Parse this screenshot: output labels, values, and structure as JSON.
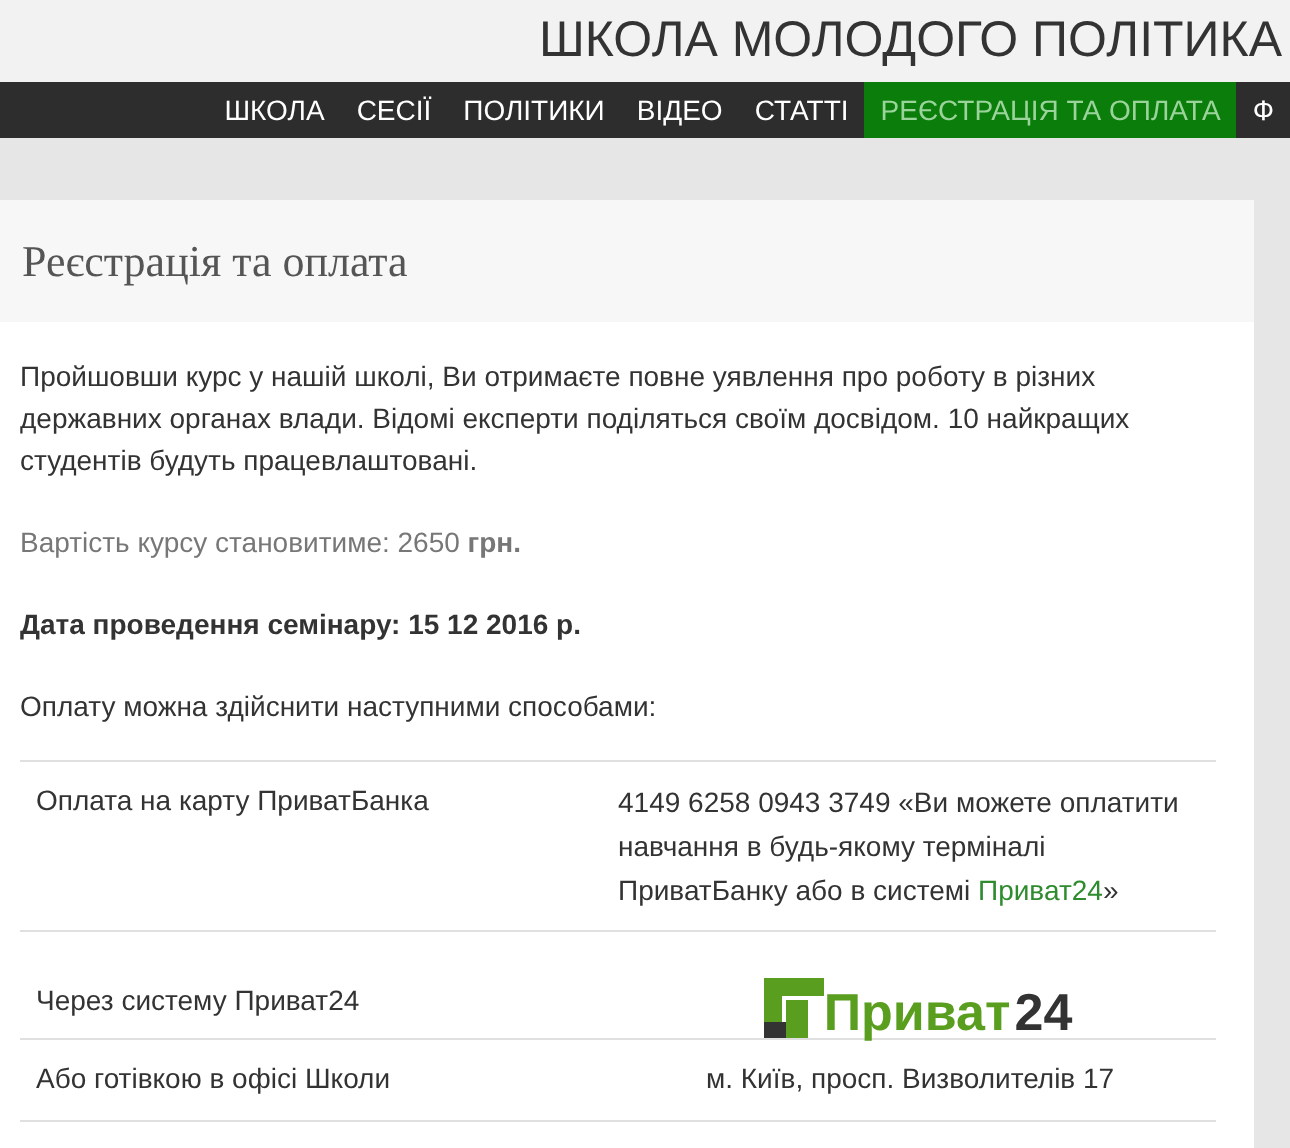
{
  "site_title": "ШКОЛА МОЛОДОГО ПОЛІТИКА",
  "nav": [
    {
      "label": "ШКОЛА",
      "selected": false
    },
    {
      "label": "СЕСІЇ",
      "selected": false
    },
    {
      "label": "ПОЛІТИКИ",
      "selected": false
    },
    {
      "label": "ВІДЕО",
      "selected": false
    },
    {
      "label": "СТАТТІ",
      "selected": false
    },
    {
      "label": "РЕЄСТРАЦІЯ ТА ОПЛАТА",
      "selected": true
    },
    {
      "label": "Ф",
      "selected": false
    }
  ],
  "page_title": "Реєстрація та оплата",
  "intro": "Пройшовши курс у нашій школі, Ви отримаєте повне уявлення про роботу в різних державних органах влади. Відомі експерти поділяться своїм досвідом. 10 найкращих студентів будуть працевлаштовані.",
  "price": "Вартість курсу становитиме: 2650 **грн.**",
  "date": "Дата проведення семінару: 15 12 2016 р.",
  "methods_intro": "Оплату можна здійснити наступними способами:",
  "payment_methods": [
    {
      "kind": "text",
      "label": "Оплата на карту ПриватБанка",
      "value": "4149 6258 0943 3749 «Ви можете оплатити навчання в будь-якому терміналі ПриватБанку або в системі ",
      "link": "Приват24",
      "value_end": "»"
    },
    {
      "kind": "logo",
      "label": "Через систему Приват24",
      "logo_word": "Приват",
      "logo_number": "24"
    },
    {
      "kind": "address",
      "label": "Або готівкою в офісі Школи",
      "value": "м. Київ, просп. Визволителів 17"
    }
  ]
}
